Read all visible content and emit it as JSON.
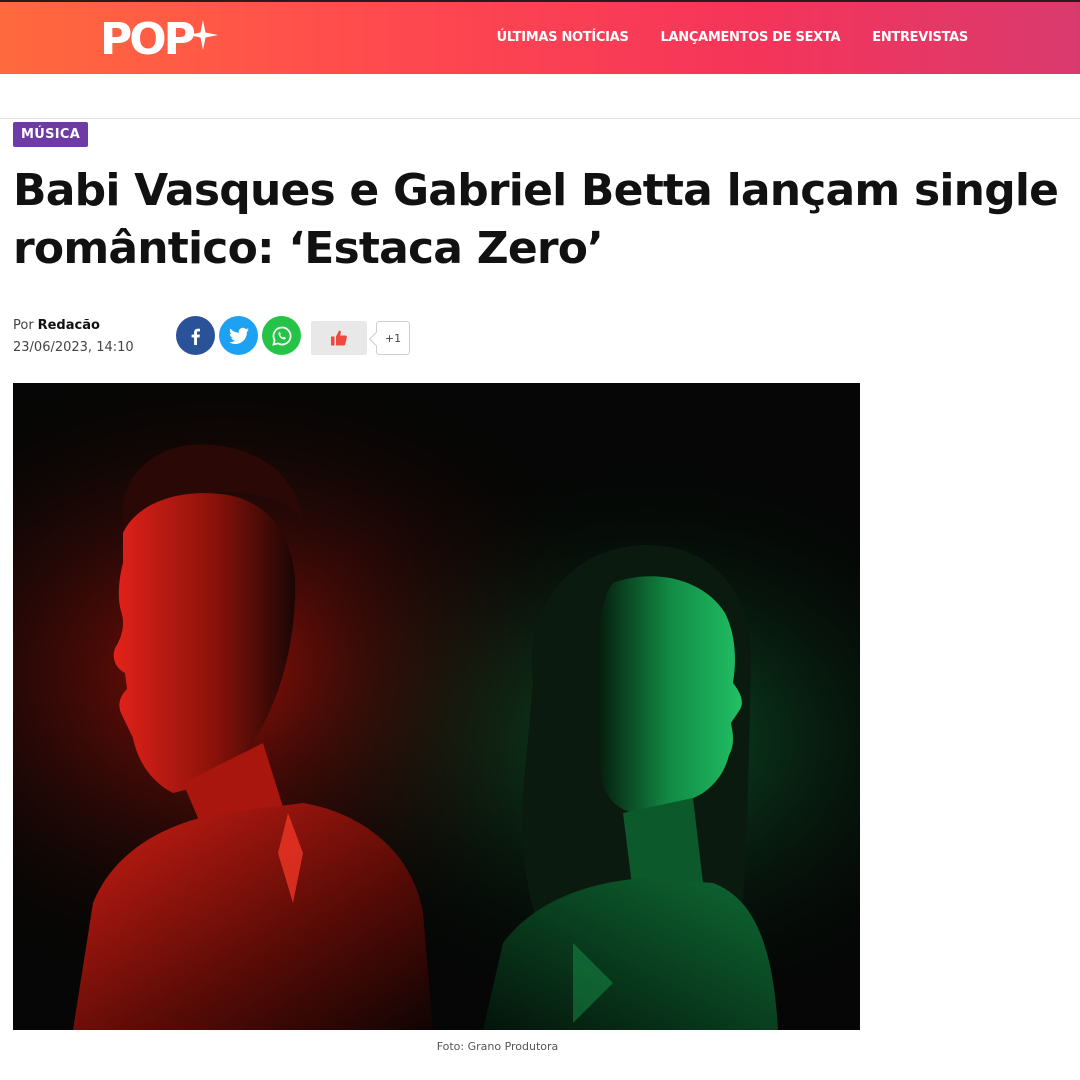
{
  "header": {
    "logo_text": "POP",
    "nav": [
      "ÚLTIMAS NOTÍCIAS",
      "LANÇAMENTOS DE SEXTA",
      "ENTREVISTAS"
    ]
  },
  "article": {
    "category": "MÚSICA",
    "title_line1": "Babi Vasques e Gabriel Betta lançam single",
    "title_line2": "romântico: ‘Estaca Zero’",
    "by_prefix": "Por",
    "author": "Redacão",
    "date": "23/06/2023, 14:10",
    "photo_caption": "Foto: Grano Produtora"
  },
  "share": {
    "icons": [
      "facebook-icon",
      "twitter-icon",
      "whatsapp-icon",
      "thumbs-up-icon"
    ],
    "like_count": "+1"
  },
  "colors": {
    "header_start": "#ff6a3d",
    "header_end": "#d93a6e",
    "category_bg": "#6d3aa6",
    "facebook": "#2a5298",
    "twitter": "#1da1f2",
    "whatsapp": "#25c447",
    "like_icon": "#f0483e"
  }
}
